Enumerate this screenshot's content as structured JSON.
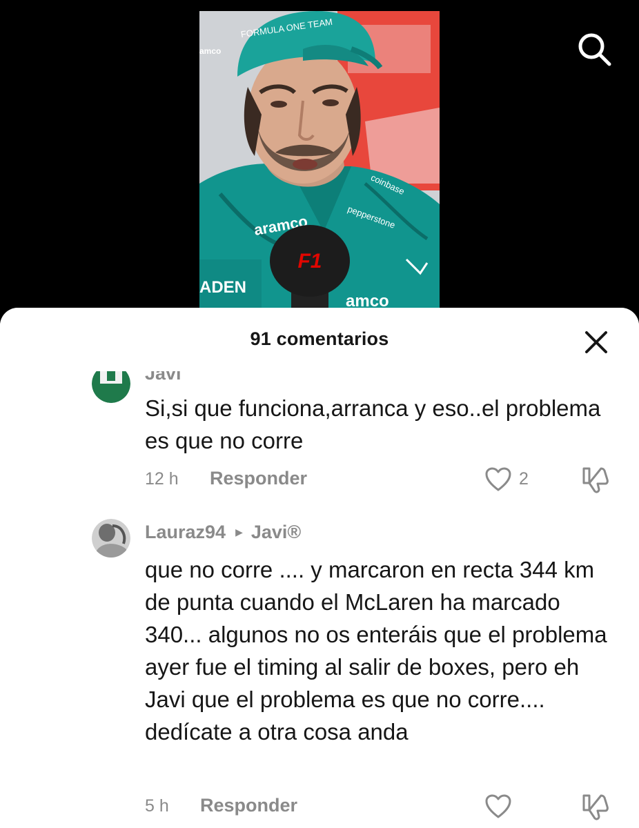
{
  "video": {
    "cap_text": "FORMULA ONE TEAM",
    "sponsor_aramco": "aramco",
    "sponsor_pepperstone": "pepperstone",
    "sponsor_coinbase": "coinbase",
    "mic_logo": "F1"
  },
  "sheet": {
    "title": "91 comentarios"
  },
  "comments": [
    {
      "author": "Javi",
      "text": "Si,si que funciona,arranca y eso..el problema es que no corre",
      "time": "12 h",
      "reply_label": "Responder",
      "likes": "2"
    },
    {
      "author": "Lauraz94",
      "reply_to": "Javi®",
      "text": "que no corre .... y marcaron en recta 344 km de punta cuando el McLaren ha marcado 340... algunos no os enteráis que el problema ayer fue el timing al salir de boxes, pero eh Javi que el problema es que no corre.... dedícate a otra cosa anda",
      "time": "5 h",
      "reply_label": "Responder",
      "likes": ""
    }
  ],
  "colors": {
    "team_teal": "#1aa39a",
    "text_primary": "#161616",
    "text_muted": "#8a8a8a",
    "sheet_bg": "#ffffff"
  }
}
